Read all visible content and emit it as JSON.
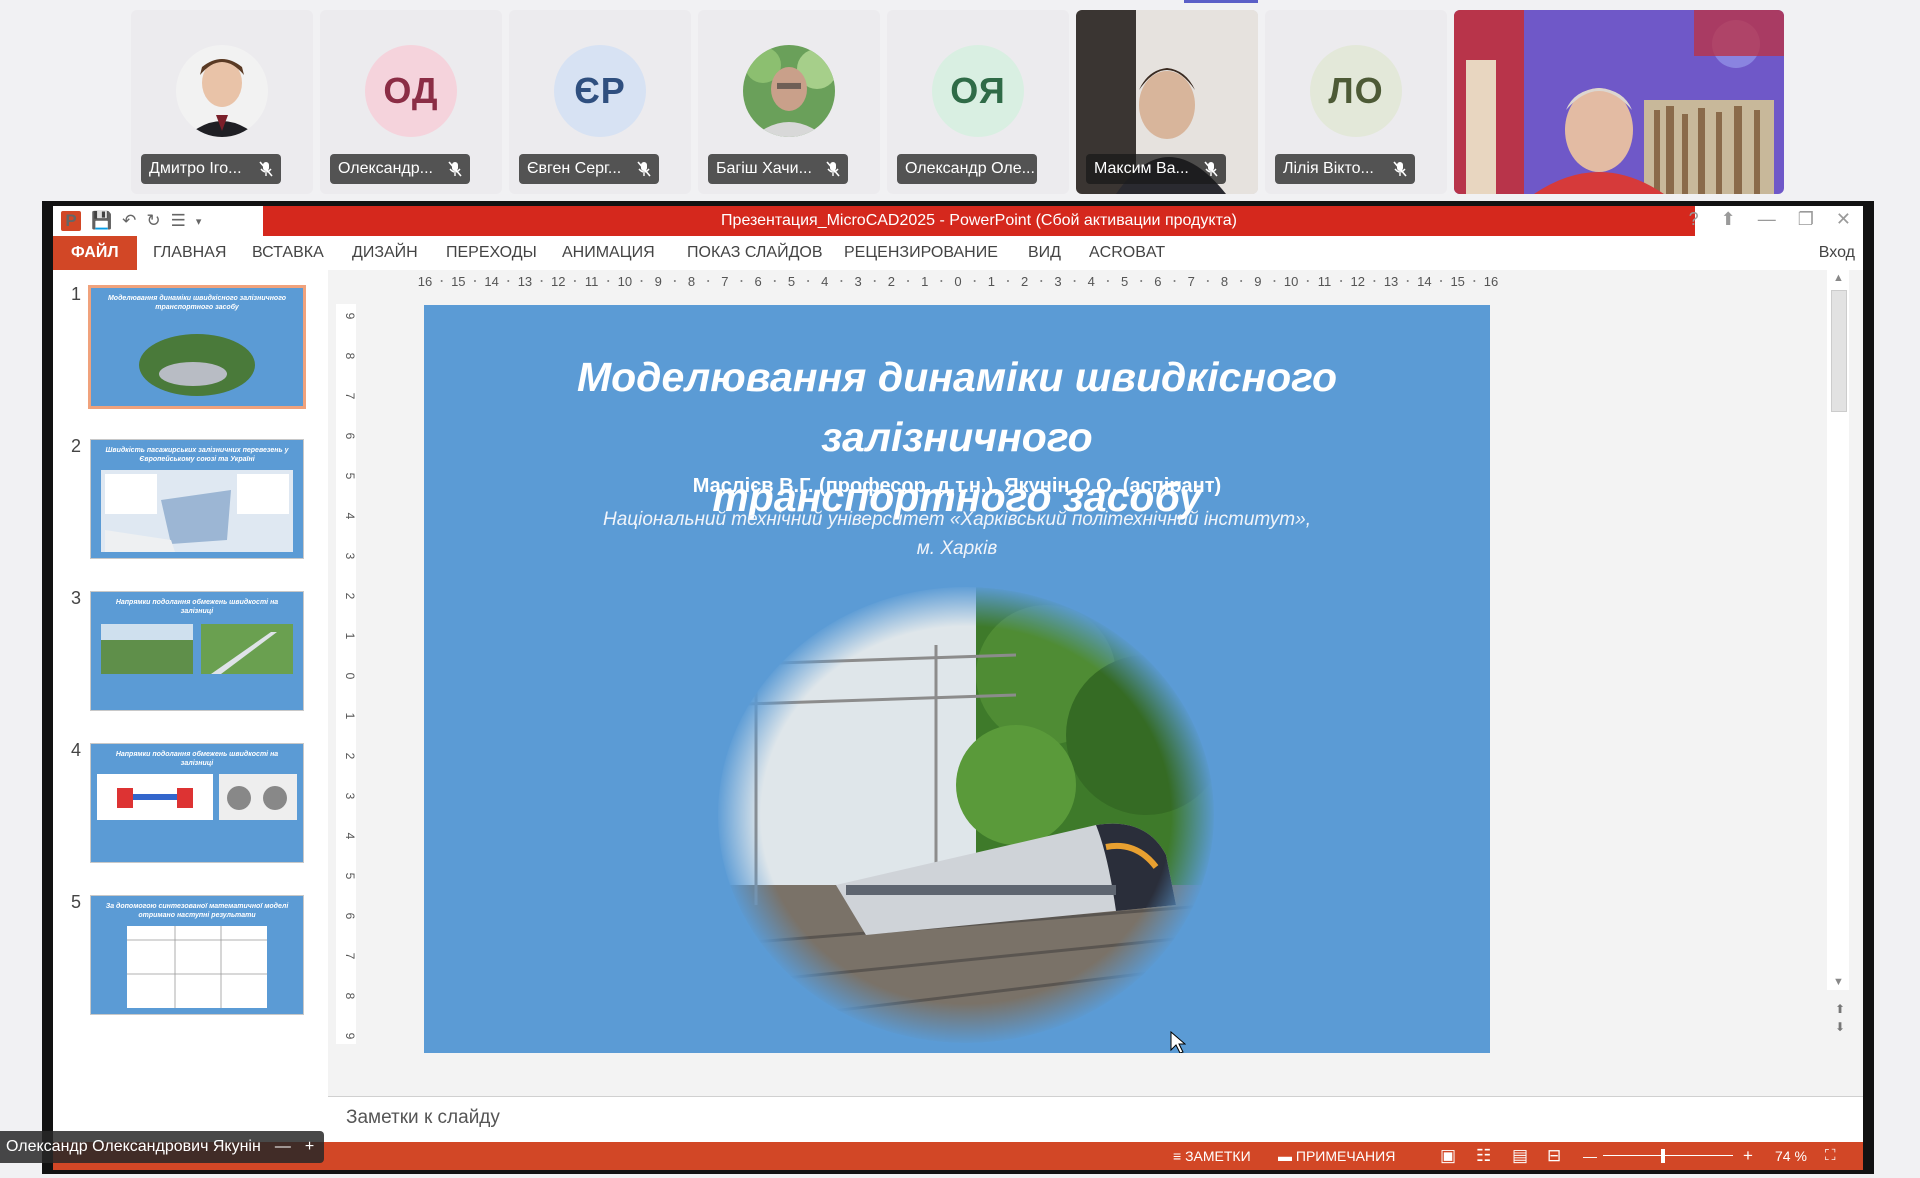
{
  "participants": [
    {
      "name": "Дмитро Іго...",
      "avatar": "photo",
      "muted": true
    },
    {
      "name": "Олександр...",
      "initials": "ОД",
      "color": "#f5d3dc",
      "text_color": "#8b2d45",
      "muted": true
    },
    {
      "name": "Євген Серг...",
      "initials": "ЄР",
      "color": "#d7e2f3",
      "text_color": "#2f4f7f",
      "muted": true
    },
    {
      "name": "Багіш Хачи...",
      "avatar": "photo",
      "muted": true
    },
    {
      "name": "Олександр Оле...",
      "initials": "ОЯ",
      "color": "#d9efe2",
      "text_color": "#2f6b47",
      "muted": false
    },
    {
      "name": "Максим Ва...",
      "avatar": "video",
      "muted": true
    },
    {
      "name": "Лілія Вікто...",
      "initials": "ЛО",
      "color": "#e3e8d9",
      "text_color": "#4d5a36",
      "muted": true
    }
  ],
  "powerpoint": {
    "window_title": "Презентация_MicroCAD2025 -  PowerPoint (Сбой активации продукта)",
    "ribbon_tabs": [
      "ФАЙЛ",
      "ГЛАВНАЯ",
      "ВСТАВКА",
      "ДИЗАЙН",
      "ПЕРЕХОДЫ",
      "АНИМАЦИЯ",
      "ПОКАЗ СЛАЙДОВ",
      "РЕЦЕНЗИРОВАНИЕ",
      "ВИД",
      "ACROBAT"
    ],
    "login_label": "Вход",
    "ruler_h": [
      "16",
      "15",
      "14",
      "13",
      "12",
      "11",
      "10",
      "9",
      "8",
      "7",
      "6",
      "5",
      "4",
      "3",
      "2",
      "1",
      "0",
      "1",
      "2",
      "3",
      "4",
      "5",
      "6",
      "7",
      "8",
      "9",
      "10",
      "11",
      "12",
      "13",
      "14",
      "15",
      "16"
    ],
    "ruler_v": [
      "9",
      "8",
      "7",
      "6",
      "5",
      "4",
      "3",
      "2",
      "1",
      "0",
      "1",
      "2",
      "3",
      "4",
      "5",
      "6",
      "7",
      "8",
      "9"
    ],
    "thumbnails": [
      {
        "number": "1",
        "title": "Моделювання динаміки швидкісного залізничного транспортного засобу"
      },
      {
        "number": "2",
        "title": "Швидкість пасажирських залізничних перевезень у Європейському союзі та Україні"
      },
      {
        "number": "3",
        "title": "Напрямки подолання обмежень швидкості на залізниці"
      },
      {
        "number": "4",
        "title": "Напрямки подолання обмежень швидкості на залізниці"
      },
      {
        "number": "5",
        "title": "За допомогою синтезованої математичної моделі отримано наступні результати"
      }
    ],
    "slide": {
      "title_line1": "Моделювання динаміки швидкісного залізничного",
      "title_line2": "транспортного засобу",
      "authors": "Маслієв В.Г. (професор, д.т.н.), Якунін О.О. (аспірант)",
      "institution_line1": "Національний технічний університет «Харківський політехнічний інститут»,",
      "institution_line2": "м. Харків"
    },
    "notes_placeholder": "Заметки к слайду",
    "status": {
      "notes": "ЗАМЕТКИ",
      "comments": "ПРИМЕЧАНИЯ",
      "zoom": "74 %"
    }
  },
  "presenter": {
    "name": "Олександр Олександрович Якунін",
    "minimize": "—",
    "add": "+"
  }
}
